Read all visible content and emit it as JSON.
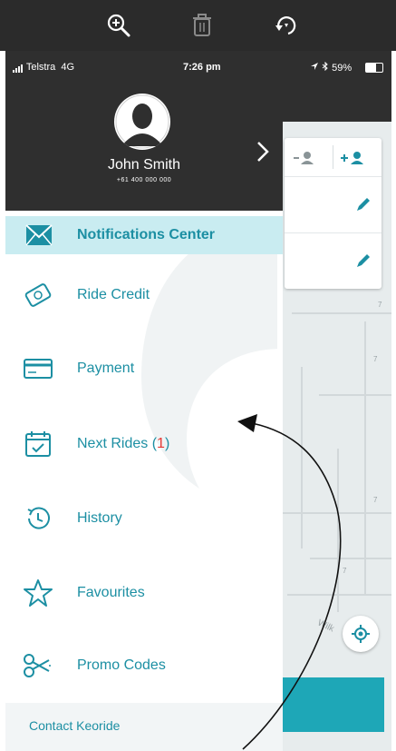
{
  "status_bar": {
    "carrier": "Telstra",
    "network": "4G",
    "time": "7:26 pm",
    "battery": "59%"
  },
  "profile": {
    "name": "John Smith",
    "phone": "+61 400 000 000"
  },
  "menu": {
    "items": [
      {
        "label": "Notifications Center",
        "icon": "envelope-icon",
        "active": true
      },
      {
        "label": "Ride Credit",
        "icon": "ticket-icon"
      },
      {
        "label": "Payment",
        "icon": "card-icon"
      },
      {
        "label": "Next Rides ",
        "badge": "(1)",
        "badge_open": "(",
        "badge_count": "1",
        "badge_close": ")",
        "icon": "calendar-icon"
      },
      {
        "label": "History",
        "icon": "clock-icon"
      },
      {
        "label": "Favourites",
        "icon": "star-icon"
      },
      {
        "label": "Promo Codes",
        "icon": "scissors-icon"
      }
    ],
    "contact_label": "Contact Keoride"
  },
  "map": {
    "street_label": "Wilk",
    "block_numbers": [
      "7",
      "7",
      "7",
      "7"
    ]
  },
  "colors": {
    "accent": "#1c8fa3",
    "active_bg": "#c9ecf1",
    "header_dark": "#2f2f2f",
    "teal_button": "#1ea7b7",
    "badge": "#e53935"
  }
}
